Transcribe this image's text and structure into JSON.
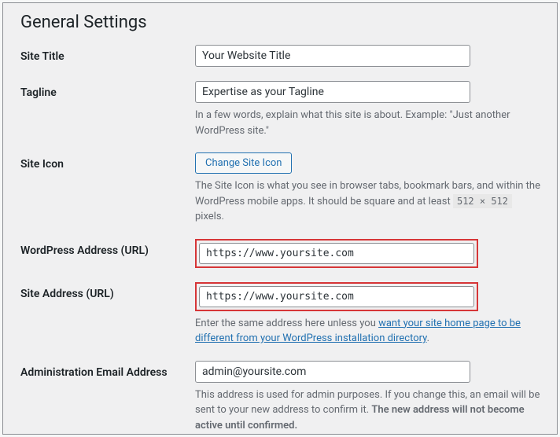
{
  "page_title": "General Settings",
  "fields": {
    "site_title": {
      "label": "Site Title",
      "value": "Your Website Title"
    },
    "tagline": {
      "label": "Tagline",
      "value": "Expertise as your Tagline",
      "description_pre": "In a few words, explain what this site is about. Example: \"Just another WordPress site.\""
    },
    "site_icon": {
      "label": "Site Icon",
      "button": "Change Site Icon",
      "description_pre": "The Site Icon is what you see in browser tabs, bookmark bars, and within the WordPress mobile apps. It should be square and at least ",
      "size_code": "512 × 512",
      "description_post": " pixels."
    },
    "wp_address": {
      "label": "WordPress Address (URL)",
      "value": "https://www.yoursite.com"
    },
    "site_address": {
      "label": "Site Address (URL)",
      "value": "https://www.yoursite.com",
      "description_pre": "Enter the same address here unless you ",
      "link_text": "want your site home page to be different from your WordPress installation directory",
      "description_post": "."
    },
    "admin_email": {
      "label": "Administration Email Address",
      "value": "admin@yoursite.com",
      "description_pre": "This address is used for admin purposes. If you change this, an email will be sent to your new address to confirm it. ",
      "description_bold": "The new address will not become active until confirmed."
    }
  }
}
